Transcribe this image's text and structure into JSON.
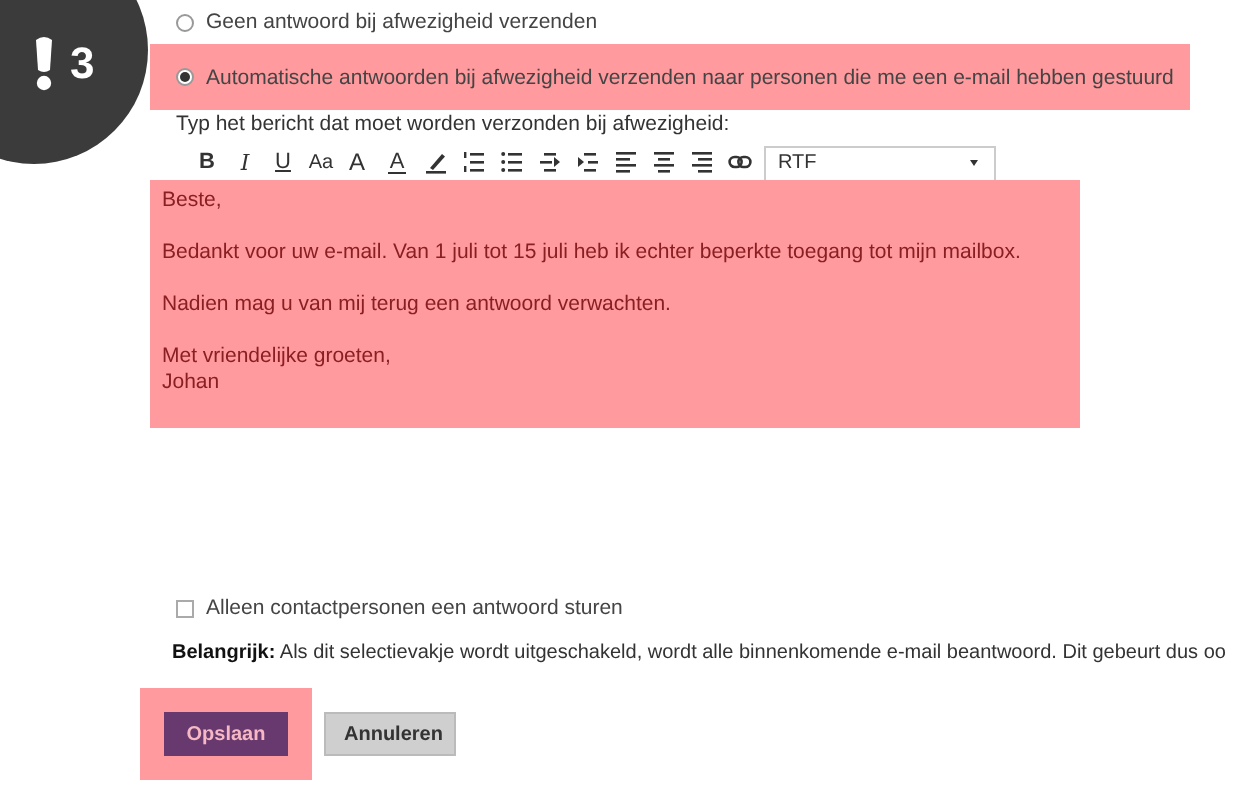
{
  "step": {
    "number": "3"
  },
  "reply_options": [
    {
      "label": "Geen antwoord bij afwezigheid verzenden",
      "selected": false,
      "highlighted": false
    },
    {
      "label": "Automatische antwoorden bij afwezigheid verzenden naar personen die me een e-mail hebben gestuurd",
      "selected": true,
      "highlighted": true
    }
  ],
  "message_label": "Typ het bericht dat moet worden verzonden bij afwezigheid:",
  "toolbar": {
    "items": [
      {
        "kind": "bold",
        "label": "B"
      },
      {
        "kind": "italic",
        "label": "I"
      },
      {
        "kind": "underline",
        "label": "U"
      },
      {
        "kind": "font-size",
        "label": "Aa"
      },
      {
        "kind": "grow-font",
        "label": "A"
      },
      {
        "kind": "font-color",
        "label": "A"
      },
      {
        "kind": "highlight"
      },
      {
        "kind": "numbered-list"
      },
      {
        "kind": "bullet-list"
      },
      {
        "kind": "outdent"
      },
      {
        "kind": "indent"
      },
      {
        "kind": "align-left"
      },
      {
        "kind": "align-center"
      },
      {
        "kind": "align-right"
      },
      {
        "kind": "link"
      }
    ],
    "format": {
      "value": "RTF"
    }
  },
  "editor": {
    "highlighted": true,
    "paragraphs": [
      {
        "lines": [
          "Beste,"
        ]
      },
      {
        "lines": [
          "Bedankt voor uw e-mail. Van 1 juli tot 15 juli heb ik echter beperkte toegang tot mijn mailbox."
        ]
      },
      {
        "lines": [
          "Nadien mag u van mij terug een antwoord verwachten."
        ]
      },
      {
        "lines": [
          "Met vriendelijke groeten,",
          "Johan"
        ]
      }
    ]
  },
  "contacts_only": {
    "label": "Alleen contactpersonen een antwoord sturen",
    "checked": false
  },
  "note": "**Belangrijk:** Als dit selectievakje wordt uitgeschakeld, wordt alle binnenkomende e-mail beantwoord. Dit gebeurt dus oo",
  "buttons": [
    {
      "label": "Opslaan",
      "kind": "primary",
      "highlighted": true
    },
    {
      "label": "Annuleren",
      "kind": "secondary",
      "highlighted": false
    }
  ]
}
